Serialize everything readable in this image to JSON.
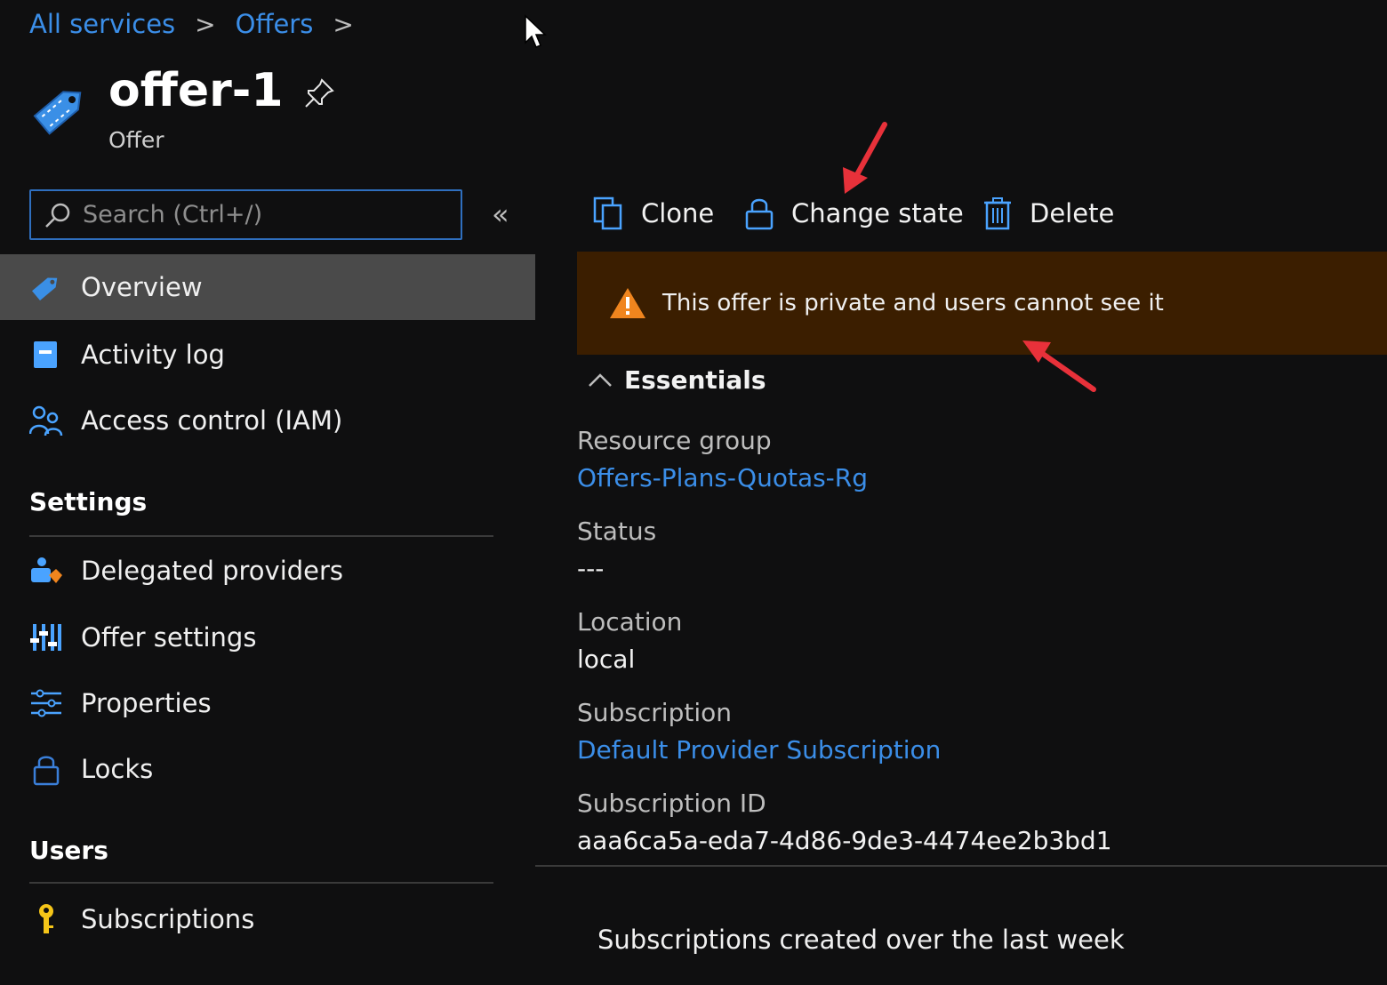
{
  "breadcrumb": {
    "items": [
      "All services",
      "Offers"
    ],
    "separator": ">"
  },
  "header": {
    "title": "offer-1",
    "subtitle": "Offer",
    "icon": "tag-icon",
    "pin_icon": "pin-icon"
  },
  "search": {
    "placeholder": "Search (Ctrl+/)",
    "collapse_label": "«"
  },
  "sidebar": {
    "items": [
      {
        "label": "Overview",
        "icon": "tag-icon",
        "active": true
      },
      {
        "label": "Activity log",
        "icon": "activity-log-icon"
      },
      {
        "label": "Access control (IAM)",
        "icon": "people-icon"
      }
    ],
    "settings": {
      "heading": "Settings",
      "items": [
        {
          "label": "Delegated providers",
          "icon": "delegated-providers-icon"
        },
        {
          "label": "Offer settings",
          "icon": "sliders-icon"
        },
        {
          "label": "Properties",
          "icon": "properties-icon"
        },
        {
          "label": "Locks",
          "icon": "lock-icon"
        }
      ]
    },
    "users": {
      "heading": "Users",
      "items": [
        {
          "label": "Subscriptions",
          "icon": "key-icon"
        }
      ]
    }
  },
  "toolbar": {
    "clone_label": "Clone",
    "change_state_label": "Change state",
    "delete_label": "Delete"
  },
  "banner": {
    "message": "This offer is private and users cannot see it",
    "icon": "warning-icon"
  },
  "essentials": {
    "heading": "Essentials",
    "fields": [
      {
        "label": "Resource group",
        "value": "Offers-Plans-Quotas-Rg",
        "link": true
      },
      {
        "label": "Status",
        "value": "---",
        "link": false
      },
      {
        "label": "Location",
        "value": "local",
        "link": false
      },
      {
        "label": "Subscription",
        "value": "Default Provider Subscription",
        "link": true
      },
      {
        "label": "Subscription ID",
        "value": "aaa6ca5a-eda7-4d86-9de3-4474ee2b3bd1",
        "link": false
      }
    ]
  },
  "chart_section": {
    "title": "Subscriptions created over the last week"
  },
  "colors": {
    "background": "#0f0f10",
    "link": "#3b8ee8",
    "banner": "#3b1e00",
    "warning": "#f0851e",
    "annotation_arrow": "#e8313a",
    "active_nav": "#4a4a4a"
  }
}
